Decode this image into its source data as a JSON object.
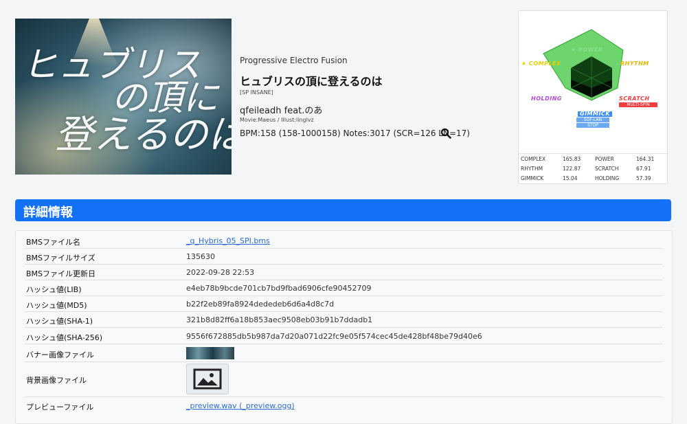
{
  "jacket": {
    "line1": "ヒュブリス",
    "line2": "の頂に",
    "line3": "登えるのは"
  },
  "song": {
    "genre": "Progressive Electro Fusion",
    "title": "ヒュブリスの頂に登えるのは",
    "difficulty": "[SP INSANE]",
    "artist": "qfeileadh feat.のあ",
    "credit": "Movie:Maeus / Illust:linglvz",
    "bpm_notes": "BPM:158 (158-1000158) Notes:3017 (SCR=126 LN=17)",
    "search_icon": "search-icon"
  },
  "radar": {
    "labels": {
      "power": "POWER",
      "complex": "COMPLEX",
      "rhythm": "RHYTHM",
      "holding": "HOLDING",
      "scratch": "SCRATCH",
      "scratch_sub": "MULTI-SPIN",
      "gimmick": "GIMMICK",
      "gimmick_sub1": "SOF-LAN",
      "gimmick_sub2": "STOP"
    },
    "stats": [
      {
        "l1": "COMPLEX",
        "v1": "165.83",
        "l2": "POWER",
        "v2": "164.31"
      },
      {
        "l1": "RHYTHM",
        "v1": "122.87",
        "l2": "SCRATCH",
        "v2": "67.91"
      },
      {
        "l1": "GIMMICK",
        "v1": "15.04",
        "l2": "HOLDING",
        "v2": "57.39"
      }
    ],
    "colors": {
      "power": "#3ec63e",
      "complex": "#e8d000",
      "rhythm": "#e8b400",
      "holding": "#b648e0",
      "scratch": "#f03c3c",
      "gimmick": "#3c8ef0"
    }
  },
  "section": {
    "title": "詳細情報"
  },
  "details": [
    {
      "label": "BMSファイル名",
      "value": "_q_Hybris_05_SPI.bms"
    },
    {
      "label": "BMSファイルサイズ",
      "value": "135630"
    },
    {
      "label": "BMSファイル更新日",
      "value": "2022-09-28 22:53"
    },
    {
      "label": "ハッシュ値(LIB)",
      "value": "e4eb78b9bcde701cb7bd9fbad6906cfe90452709"
    },
    {
      "label": "ハッシュ値(MD5)",
      "value": "b22f2eb89fa8924dededeb6d6a4d8c7d"
    },
    {
      "label": "ハッシュ値(SHA-1)",
      "value": "321b8d82ff6a18b853aec9508eb03b91b7ddadb1"
    },
    {
      "label": "ハッシュ値(SHA-256)",
      "value": "9556f672885db5b987da7d20a071d22fc9e05f574cec45de428bf48be79d40e6"
    },
    {
      "label": "バナー画像ファイル",
      "value": ""
    },
    {
      "label": "背景画像ファイル",
      "value": ""
    },
    {
      "label": "プレビューファイル",
      "value": "_preview.wav (_preview.ogg)"
    }
  ]
}
